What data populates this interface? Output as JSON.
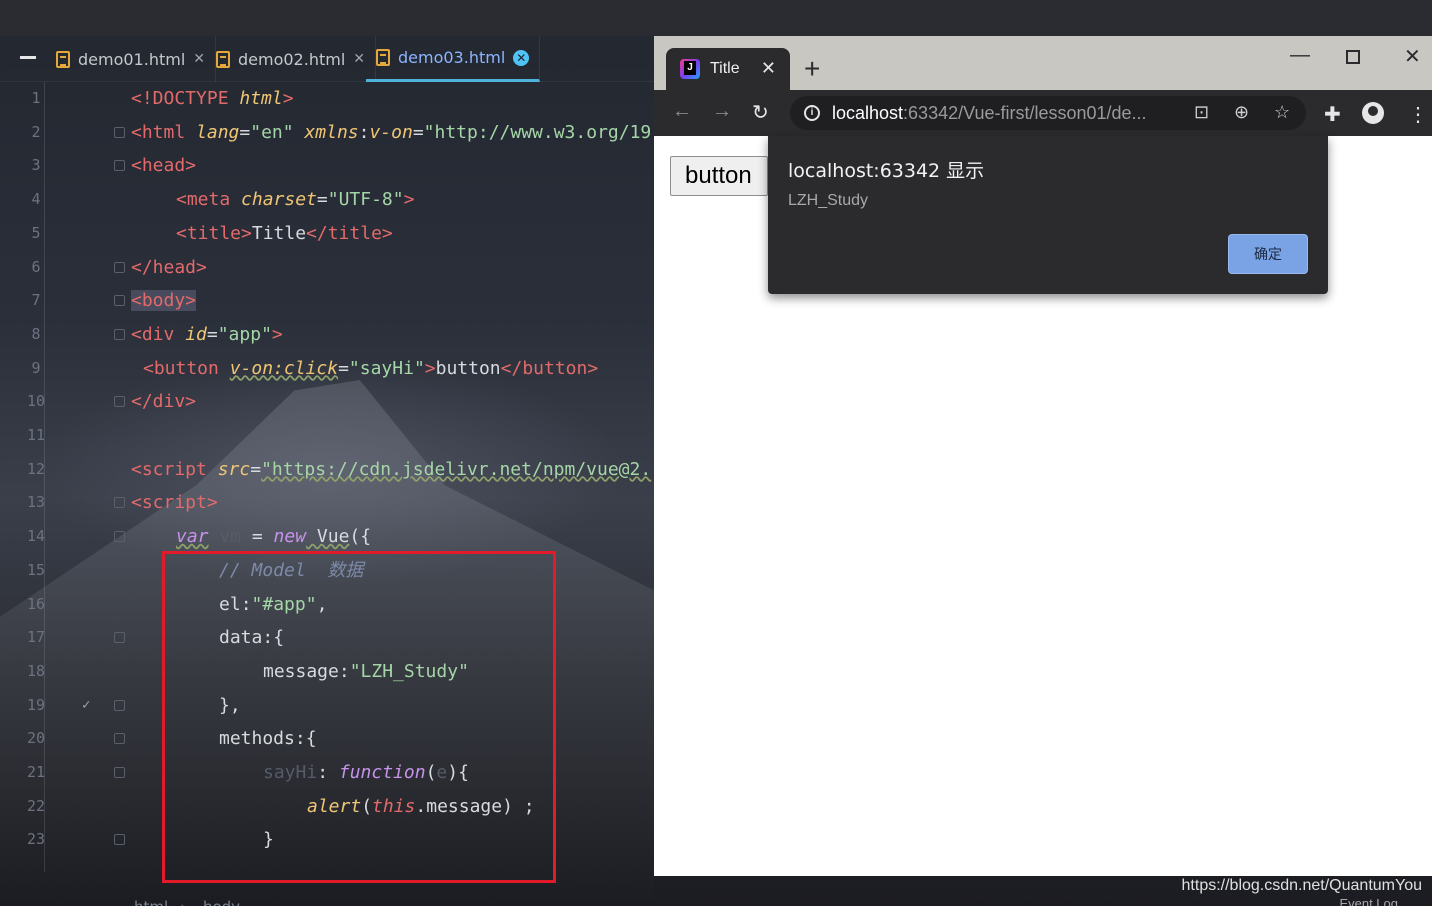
{
  "ide": {
    "tabs": [
      {
        "label": "demo01.html"
      },
      {
        "label": "demo02.html"
      },
      {
        "label": "demo03.html",
        "active": true
      }
    ],
    "lines": [
      {
        "n": "1"
      },
      {
        "n": "2"
      },
      {
        "n": "3"
      },
      {
        "n": "4"
      },
      {
        "n": "5"
      },
      {
        "n": "6"
      },
      {
        "n": "7"
      },
      {
        "n": "8"
      },
      {
        "n": "9"
      },
      {
        "n": "10"
      },
      {
        "n": "11"
      },
      {
        "n": "12"
      },
      {
        "n": "13"
      },
      {
        "n": "14"
      },
      {
        "n": "15"
      },
      {
        "n": "16"
      },
      {
        "n": "17"
      },
      {
        "n": "18"
      },
      {
        "n": "19"
      },
      {
        "n": "20"
      },
      {
        "n": "21"
      },
      {
        "n": "22"
      },
      {
        "n": "23"
      }
    ],
    "code": {
      "l1_open": "<!DOCTYPE ",
      "l1_attr": "html",
      "l1_close": ">",
      "l2_tag": "<html ",
      "l2_attr1": "lang",
      "l2_eq1": "=",
      "l2_val1": "\"en\"",
      "l2_attr2": " xmlns",
      "l2_colon": ":",
      "l2_attr3": "v-on",
      "l2_eq2": "=",
      "l2_val2": "\"http://www.w3.org/19",
      "l3": "<head>",
      "l4_tag": "<meta ",
      "l4_attr": "charset",
      "l4_eq": "=",
      "l4_val": "\"UTF-8\"",
      "l4_close": ">",
      "l5_open": "<title>",
      "l5_text": "Title",
      "l5_close": "</title>",
      "l6": "</head>",
      "l7": "<body>",
      "l8_tag": "<div ",
      "l8_attr": "id",
      "l8_eq": "=",
      "l8_val": "\"app\"",
      "l8_close": ">",
      "l9_tag": "<button ",
      "l9_attr": "v-on:click",
      "l9_eq": "=",
      "l9_val": "\"sayHi\"",
      "l9_gt": ">",
      "l9_text": "button",
      "l9_close": "</button>",
      "l10": "</div>",
      "l12_tag": "<script ",
      "l12_attr": "src",
      "l12_eq": "=",
      "l12_val": "\"https://cdn.jsdelivr.net/npm/vue@2.",
      "l13": "<script>",
      "l14_var": "var",
      "l14_vm": " vm",
      "l14_eq": " = ",
      "l14_new": "new",
      "l14_vue": " Vue",
      "l14_paren": "({",
      "l15": "// Model  数据",
      "l16_key": "el",
      "l16_colon": ":",
      "l16_val": "\"#app\"",
      "l16_comma": ",",
      "l17_key": "data",
      "l17_rest": ":{",
      "l18_key": "message",
      "l18_colon": ":",
      "l18_val": "\"LZH_Study\"",
      "l19": "},",
      "l20_key": "methods",
      "l20_rest": ":{",
      "l21_name": "sayHi",
      "l21_colon": ": ",
      "l21_fn": "function",
      "l21_p1": "(",
      "l21_arg": "e",
      "l21_p2": "){",
      "l22_alert": "alert",
      "l22_p1": "(",
      "l22_this": "this",
      "l22_rest": ".message) ;",
      "l23": "}"
    },
    "breadcrumb": [
      "html",
      "body"
    ]
  },
  "browser": {
    "tab_title": "Title",
    "address_host": "localhost",
    "address_rest": ":63342/Vue-first/lesson01/de...",
    "page_button_label": "button",
    "dialog": {
      "title": "localhost:63342 显示",
      "message": "LZH_Study",
      "ok_label": "确定"
    }
  },
  "watermark": "https://blog.csdn.net/QuantumYou",
  "event_log": "Event Log",
  "colors": {
    "accent_tab": "#4fb3d9",
    "highlight_box": "#e21b2a",
    "dialog_ok": "#7aa3e6"
  }
}
